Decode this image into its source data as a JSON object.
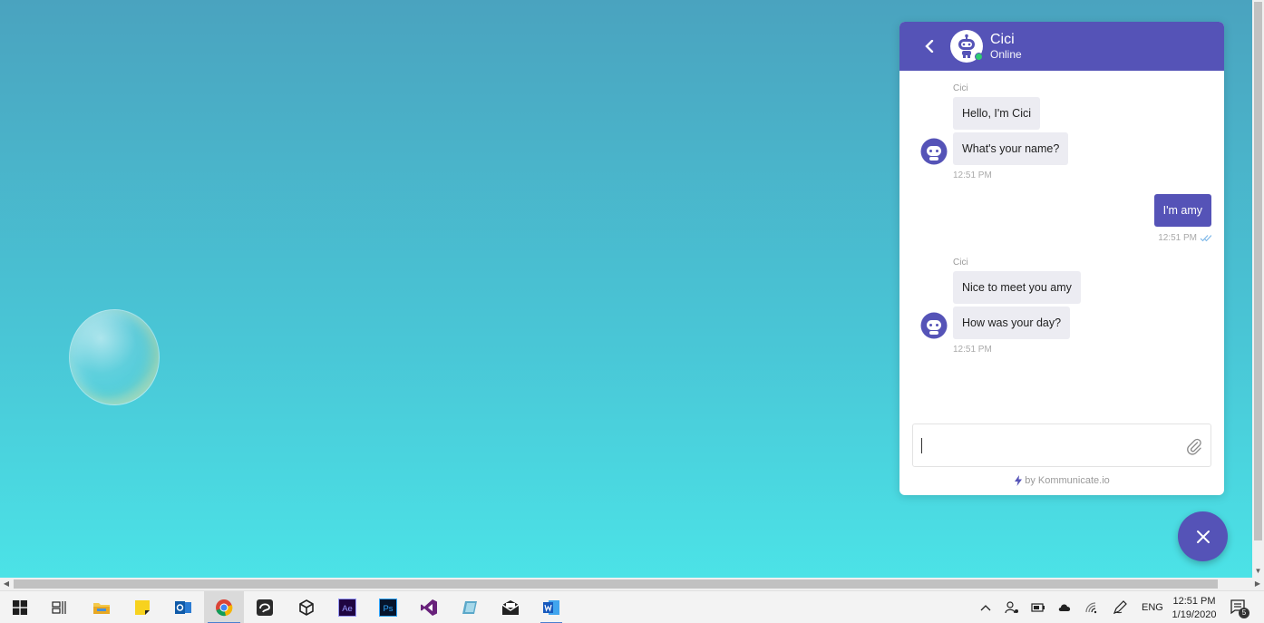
{
  "chat": {
    "header": {
      "name": "Cici",
      "status": "Online"
    },
    "messages": [
      {
        "sender": "Cici",
        "bubbles": [
          "Hello, I'm Cici",
          "What's your name?"
        ],
        "time": "12:51 PM"
      },
      {
        "sent": "I'm amy",
        "time": "12:51 PM"
      },
      {
        "sender": "Cici",
        "bubbles": [
          "Nice to meet you amy",
          "How was your day?"
        ],
        "time": "12:51 PM"
      }
    ],
    "composer": {
      "value": "",
      "placeholder": ""
    },
    "powered_by": "by Kommunicate.io"
  },
  "colors": {
    "brand": "#5553b7",
    "online": "#2ecc71",
    "bubble": "#ececf2"
  },
  "taskbar": {
    "apps": [
      "start-icon",
      "task-view-icon",
      "file-explorer-icon",
      "sticky-notes-icon",
      "outlook-icon",
      "chrome-icon",
      "inkscape-icon",
      "unity-icon",
      "after-effects-icon",
      "photoshop-icon",
      "visual-studio-icon",
      "app-icon",
      "mail-icon",
      "word-icon"
    ],
    "ae_label": "Ae",
    "ps_label": "Ps",
    "language": "ENG",
    "time": "12:51 PM",
    "date": "1/19/2020",
    "notification_count": "5"
  }
}
